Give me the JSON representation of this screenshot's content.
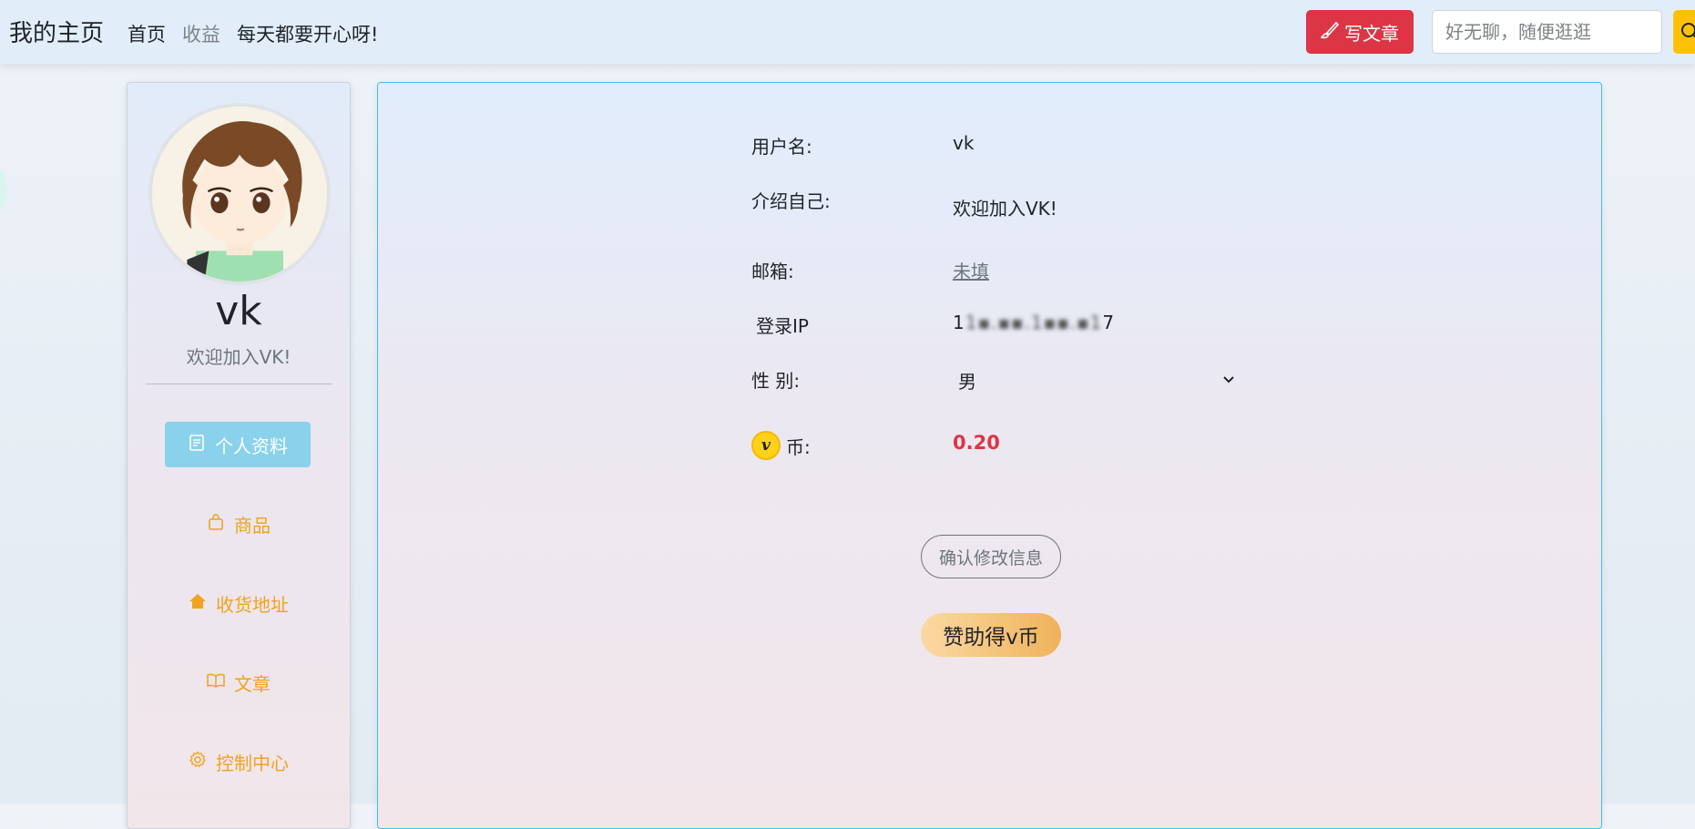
{
  "nav": {
    "brand": "我的主页",
    "links": [
      "首页",
      "收益",
      "每天都要开心呀!"
    ],
    "write_label": "写文章",
    "search_placeholder": "好无聊，随便逛逛"
  },
  "sidebar": {
    "name": "vk",
    "intro": "欢迎加入VK!",
    "menu": [
      {
        "label": "个人资料",
        "icon": "profile-icon",
        "active": true
      },
      {
        "label": "商品",
        "icon": "bag-icon"
      },
      {
        "label": "收货地址",
        "icon": "home-icon"
      },
      {
        "label": "文章",
        "icon": "book-icon"
      },
      {
        "label": "控制中心",
        "icon": "gear-icon"
      }
    ]
  },
  "profile": {
    "username_label": "用户名:",
    "username": "vk",
    "intro_label": "介绍自己:",
    "intro": "欢迎加入VK!",
    "email_label": "邮箱:",
    "email": "未填",
    "ip_label": "登录IP",
    "ip_prefix": "1",
    "ip_hidden": "1▪.▪▪.1▪▪.▪1",
    "ip_suffix": "7",
    "gender_label": "性 别:",
    "gender": "男",
    "coin_symbol": "v",
    "coin_label": "币:",
    "coin_value": "0.20",
    "confirm_label": "确认修改信息",
    "sponsor_label": "赞助得v币"
  },
  "colors": {
    "accent_red": "#dc3545",
    "accent_yellow": "#ffc107",
    "menu_orange": "#f0a31d",
    "menu_active": "#8ad2ec",
    "panel_border": "#3fc1e6"
  }
}
